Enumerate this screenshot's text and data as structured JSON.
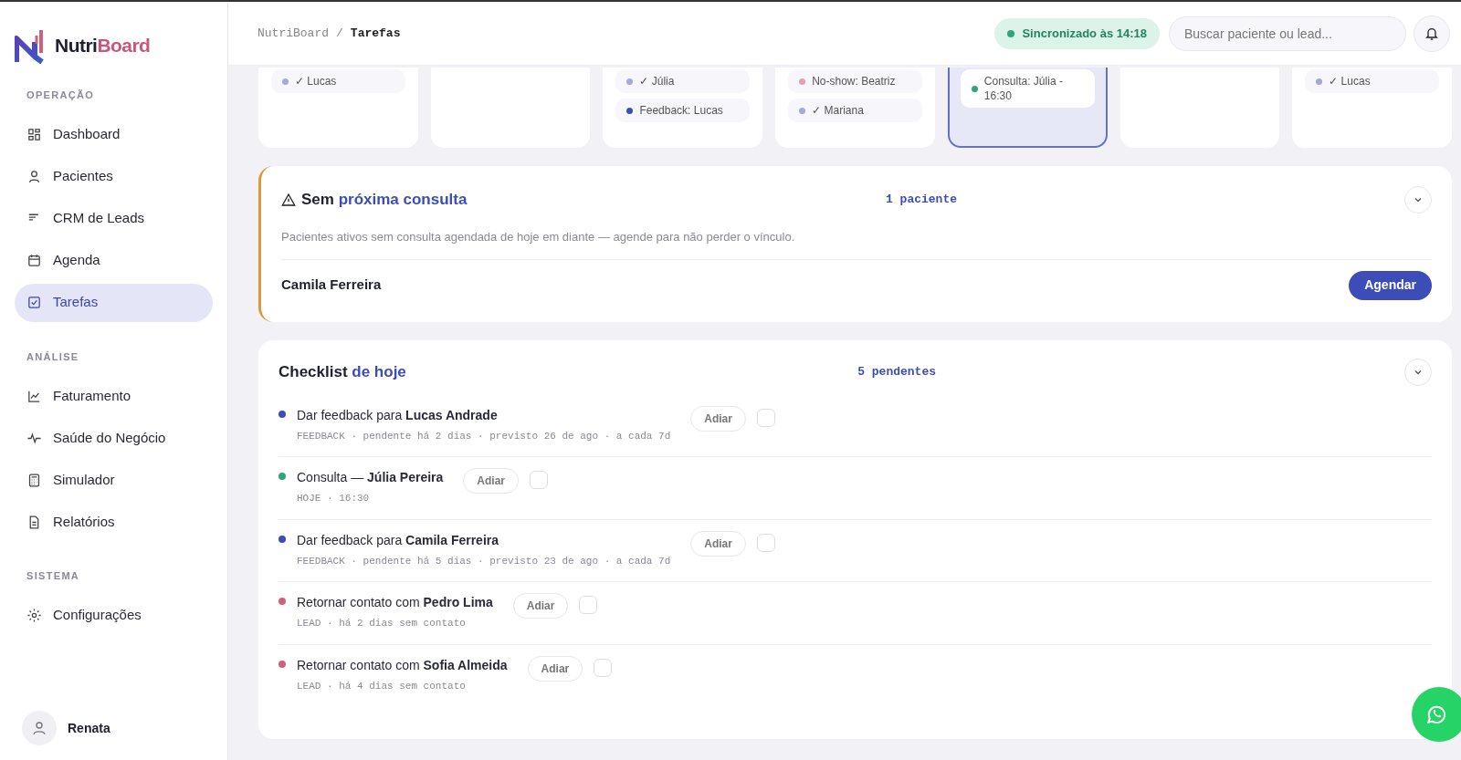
{
  "brand": {
    "first": "Nutri",
    "second": "Board"
  },
  "sidebar": {
    "sections": [
      {
        "heading": "OPERAÇÃO",
        "items": [
          {
            "label": "Dashboard",
            "selected": false
          },
          {
            "label": "Pacientes",
            "selected": false
          },
          {
            "label": "CRM de Leads",
            "selected": false
          },
          {
            "label": "Agenda",
            "selected": false
          },
          {
            "label": "Tarefas",
            "selected": true
          }
        ]
      },
      {
        "heading": "ANÁLISE",
        "items": [
          {
            "label": "Faturamento",
            "selected": false
          },
          {
            "label": "Saúde do Negócio",
            "selected": false
          },
          {
            "label": "Simulador",
            "selected": false
          },
          {
            "label": "Relatórios",
            "selected": false
          }
        ]
      },
      {
        "heading": "SISTEMA",
        "items": [
          {
            "label": "Configurações",
            "selected": false
          }
        ]
      }
    ],
    "user": {
      "name": "Renata"
    }
  },
  "header": {
    "breadcrumb": [
      "NutriBoard",
      "/",
      "Tarefas"
    ],
    "sync": "Sincronizado às 14:18",
    "search": {
      "placeholder": "Buscar paciente ou lead..."
    }
  },
  "calendar": [
    {
      "selected": false,
      "chips": [
        {
          "text": "✓ Lucas",
          "color": "#a5a8d8"
        }
      ]
    },
    {
      "selected": false
    },
    {
      "selected": false,
      "chips": [
        {
          "text": "✓ Júlia",
          "color": "#a5a8d8"
        },
        {
          "text": "Feedback: Lucas",
          "color": "#3d4db7"
        }
      ]
    },
    {
      "selected": false,
      "chips": [
        {
          "text": "No-show: Beatriz",
          "color": "#e8a0b0"
        },
        {
          "text": "✓ Mariana",
          "color": "#a5a8d8"
        }
      ]
    },
    {
      "selected": true,
      "chips": [
        {
          "text": "Consulta: Júlia - 16:30",
          "color": "#2fa57a"
        }
      ]
    },
    {
      "selected": false
    },
    {
      "selected": false,
      "chips": [
        {
          "text": "✓ Lucas",
          "color": "#a5a8d8"
        }
      ]
    }
  ],
  "no_appointment": {
    "title": "Sem",
    "title_accent": "próxima consulta",
    "count": "1 paciente",
    "description": "Pacientes ativos sem consulta agendada de hoje em diante — agende para não perder o vínculo.",
    "rows": [
      {
        "name": "Camila Ferreira",
        "button": "Agendar"
      }
    ]
  },
  "checklist": {
    "title": "Checklist",
    "title_accent": "de hoje",
    "count": "5 pendentes",
    "items": [
      {
        "color": "#3d4db7",
        "text": "Dar feedback para **Lucas Andrade**",
        "meta": "FEEDBACK · pendente há 2 dias · previsto 26 de ago · a cada 7d",
        "button": "Adiar",
        "checked": false
      },
      {
        "color": "#2fa57a",
        "text": "Consulta — **Júlia Pereira**",
        "meta": "HOJE · 16:30",
        "button": "Adiar",
        "checked": false
      },
      {
        "color": "#3d4db7",
        "text": "Dar feedback para **Camila Ferreira**",
        "meta": "FEEDBACK · pendente há 5 dias · previsto 23 de ago · a cada 7d",
        "button": "Adiar",
        "checked": false
      },
      {
        "color": "#d0607e",
        "text": "Retornar contato com **Pedro Lima**",
        "meta": "LEAD · há 2 dias sem contato",
        "button": "Adiar",
        "checked": false
      },
      {
        "color": "#d0607e",
        "text": "Retornar contato com **Sofia Almeida**",
        "meta": "LEAD · há 4 dias sem contato",
        "button": "Adiar",
        "checked": false
      }
    ]
  }
}
